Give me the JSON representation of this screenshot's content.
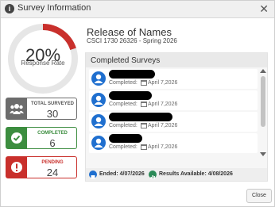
{
  "dialog": {
    "title": "Survey Information",
    "close_label": "Close"
  },
  "gauge": {
    "percent_text": "20%",
    "label": "Response Rate",
    "fraction": 0.2,
    "track_color": "#e6e6e6",
    "fill_color": "#c9302c"
  },
  "stats": {
    "total_label": "TOTAL SURVEYED",
    "total_value": "30",
    "completed_label": "COMPLETED",
    "completed_value": "6",
    "pending_label": "PENDING",
    "pending_value": "24"
  },
  "course": {
    "name": "Release of Names",
    "subtitle": "CSCI 1730 26326 - Spring 2026"
  },
  "completed_surveys": {
    "header": "Completed Surveys",
    "rows": [
      {
        "status": "Completed:",
        "date": "April 7,2026"
      },
      {
        "status": "Completed:",
        "date": "April 7,2026"
      },
      {
        "status": "Completed:",
        "date": "April 7,2026"
      },
      {
        "status": "Completed:",
        "date": "April 7,2026"
      }
    ]
  },
  "footer_info": {
    "ended": "Ended: 4/07/2026",
    "results": "Results Available: 4/08/2026"
  },
  "colors": {
    "accent": "#1f6fcf",
    "success": "#3c8d3f",
    "danger": "#c9302c",
    "neutral": "#6c6c6c"
  }
}
